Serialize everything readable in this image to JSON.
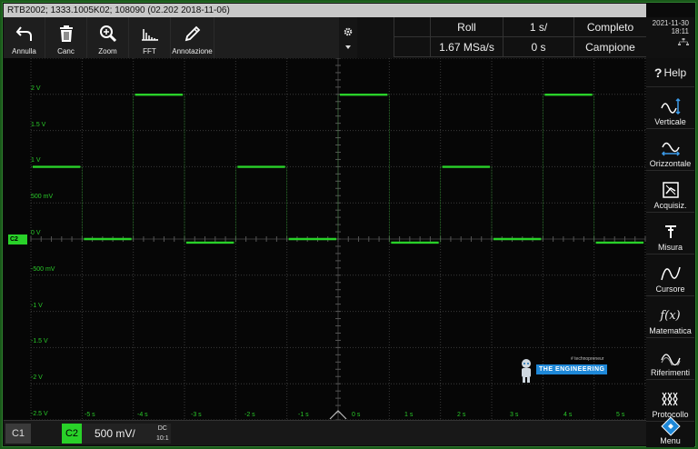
{
  "title_bar": "RTB2002; 1333.1005K02; 108090 (02.202 2018-11-06)",
  "toolbar": [
    {
      "label": "Annulla",
      "icon": "undo-icon"
    },
    {
      "label": "Canc",
      "icon": "trash-icon"
    },
    {
      "label": "Zoom",
      "icon": "zoom-icon"
    },
    {
      "label": "FFT",
      "icon": "fft-icon"
    },
    {
      "label": "Annotazione",
      "icon": "pencil-icon"
    }
  ],
  "status": {
    "mode": "Roll",
    "timebase": "1 s/",
    "acq_state": "Completo",
    "sample_rate": "1.67 MSa/s",
    "offset": "0 s",
    "acq_mode": "Campione"
  },
  "clock": {
    "date": "2021-11-30",
    "time": "18:11"
  },
  "sidebar": [
    {
      "label": "Help",
      "icon": "help-icon"
    },
    {
      "label": "Verticale",
      "icon": "vertical-icon"
    },
    {
      "label": "Orizzontale",
      "icon": "horizontal-icon"
    },
    {
      "label": "Acquisiz.",
      "icon": "acquisition-icon"
    },
    {
      "label": "Misura",
      "icon": "measure-icon"
    },
    {
      "label": "Cursore",
      "icon": "cursor-icon"
    },
    {
      "label": "Matematica",
      "icon": "math-icon"
    },
    {
      "label": "Riferimenti",
      "icon": "reference-icon"
    },
    {
      "label": "Protocollo",
      "icon": "protocol-icon"
    },
    {
      "label": "Menu",
      "icon": "menu-icon"
    }
  ],
  "channels": {
    "ch1_label": "C1",
    "ch2_label": "C2",
    "ch2_scale": "500 mV/",
    "ch2_coupling": "DC",
    "ch2_probe": "10:1",
    "ch2_marker": "C2"
  },
  "watermark": {
    "tagline": "# technopreneur",
    "name": "THE ENGINEERING"
  },
  "colors": {
    "trace": "#29d129",
    "grid": "#3a3a3a",
    "label": "#29c829"
  },
  "chart_data": {
    "type": "line",
    "y_ticks": [
      "2 V",
      "1.5 V",
      "1 V",
      "500 mV",
      "0 V",
      "-500 mV",
      "-1 V",
      "-1.5 V",
      "-2 V",
      "-2.5 V"
    ],
    "x_ticks": [
      "-5 s",
      "-4 s",
      "-3 s",
      "-2 s",
      "-1 s",
      "0 s",
      "1 s",
      "2 s",
      "3 s",
      "4 s",
      "5 s"
    ],
    "ylim": [
      -2.5,
      2.5
    ],
    "xlim": [
      -6,
      6
    ],
    "series": [
      {
        "x": [
          -6,
          -5,
          -5,
          -4,
          -4,
          -3,
          -3,
          -2,
          -2,
          -1,
          -1,
          0,
          0,
          1,
          1,
          2,
          2,
          3,
          3,
          4,
          4,
          5,
          5,
          6
        ],
        "y": [
          1,
          1,
          0,
          0,
          2,
          2,
          -0.05,
          -0.05,
          1,
          1,
          0,
          0,
          2,
          2,
          -0.05,
          -0.05,
          1,
          1,
          0,
          0,
          2,
          2,
          -0.05,
          -0.05
        ]
      }
    ]
  }
}
